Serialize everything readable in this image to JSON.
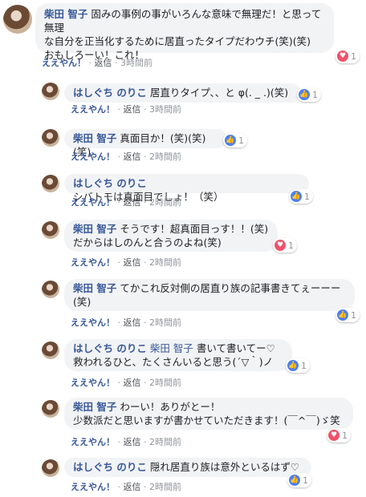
{
  "comments": [
    {
      "author": "柴田 智子",
      "text_lines": [
        "固みの事例の事がいろんな意味で無理だ！と思って無理",
        "な自分を正当化するために居直ったタイプだわウチ(笑)(笑)",
        "おもしろーい！これ！"
      ],
      "like_label": "ええやん！",
      "reply_label": "返信",
      "time": "3時間前",
      "reaction_type": "love",
      "reaction_count": "1",
      "replies": [
        {
          "author": "はしぐち のりこ",
          "text": "居直りタイプ、、と φ(. _ .)(笑)",
          "like_label": "ええやん！",
          "reply_label": "返信",
          "time": "3時間前",
          "reaction_type": "like",
          "reaction_count": "1"
        },
        {
          "author": "柴田 智子",
          "text": "真面目か！(笑)(笑)(笑)",
          "like_label": "ええやん！",
          "reply_label": "返信",
          "time": "2時間前",
          "reaction_type": "like",
          "reaction_count": "1"
        },
        {
          "author": "はしぐち のりこ",
          "text": "シバトモは真面目でしょ！（笑）",
          "like_label": "ええやん！",
          "reply_label": "返信",
          "time": "2時間前",
          "reaction_type": "like",
          "reaction_count": "1"
        },
        {
          "author": "柴田 智子",
          "text": "そうです！超真面目っす！！(笑)",
          "text2": "だからはしのんと合うのよね(笑)",
          "like_label": "ええやん！",
          "reply_label": "返信",
          "time": "2時間前",
          "reaction_type": "love",
          "reaction_count": "1"
        },
        {
          "author": "柴田 智子",
          "text": "てかこれ反対側の居直り族の記事書きてぇーーー",
          "text2": "(笑)",
          "like_label": "ええやん！",
          "reply_label": "返信",
          "time": "2時間前",
          "reaction_type": "like",
          "reaction_count": "1"
        },
        {
          "author": "はしぐち のりこ",
          "mention": "柴田 智子",
          "text": "書いて書いてー♡",
          "text2": "救われるひと、たくさんいると思う(´▽｀)ノ",
          "like_label": "ええやん！",
          "reply_label": "返信",
          "time": "2時間前",
          "reaction_type": "like",
          "reaction_count": "1"
        },
        {
          "author": "柴田 智子",
          "text": "わーい！ありがとー！",
          "text2": "少数派だと思いますが書かせていただきます！(￣^￣)ゞ笑",
          "like_label": "ええやん！",
          "reply_label": "返信",
          "time": "2時間前",
          "reaction_type": "love",
          "reaction_count": "1"
        },
        {
          "author": "はしぐち のりこ",
          "text": "隠れ居直り族は意外といるはず♡",
          "like_label": "ええやん！",
          "reply_label": "返信",
          "time": "2時間前",
          "reaction_type": "like",
          "reaction_count": "1"
        }
      ]
    }
  ],
  "colors": {
    "author": "#385898",
    "bubble": "#f2f3f5",
    "like": "#4d80f1",
    "love": "#f0526b",
    "meta": "#90949c"
  },
  "icons": {
    "like": "thumbs-up-icon",
    "love": "heart-icon"
  }
}
